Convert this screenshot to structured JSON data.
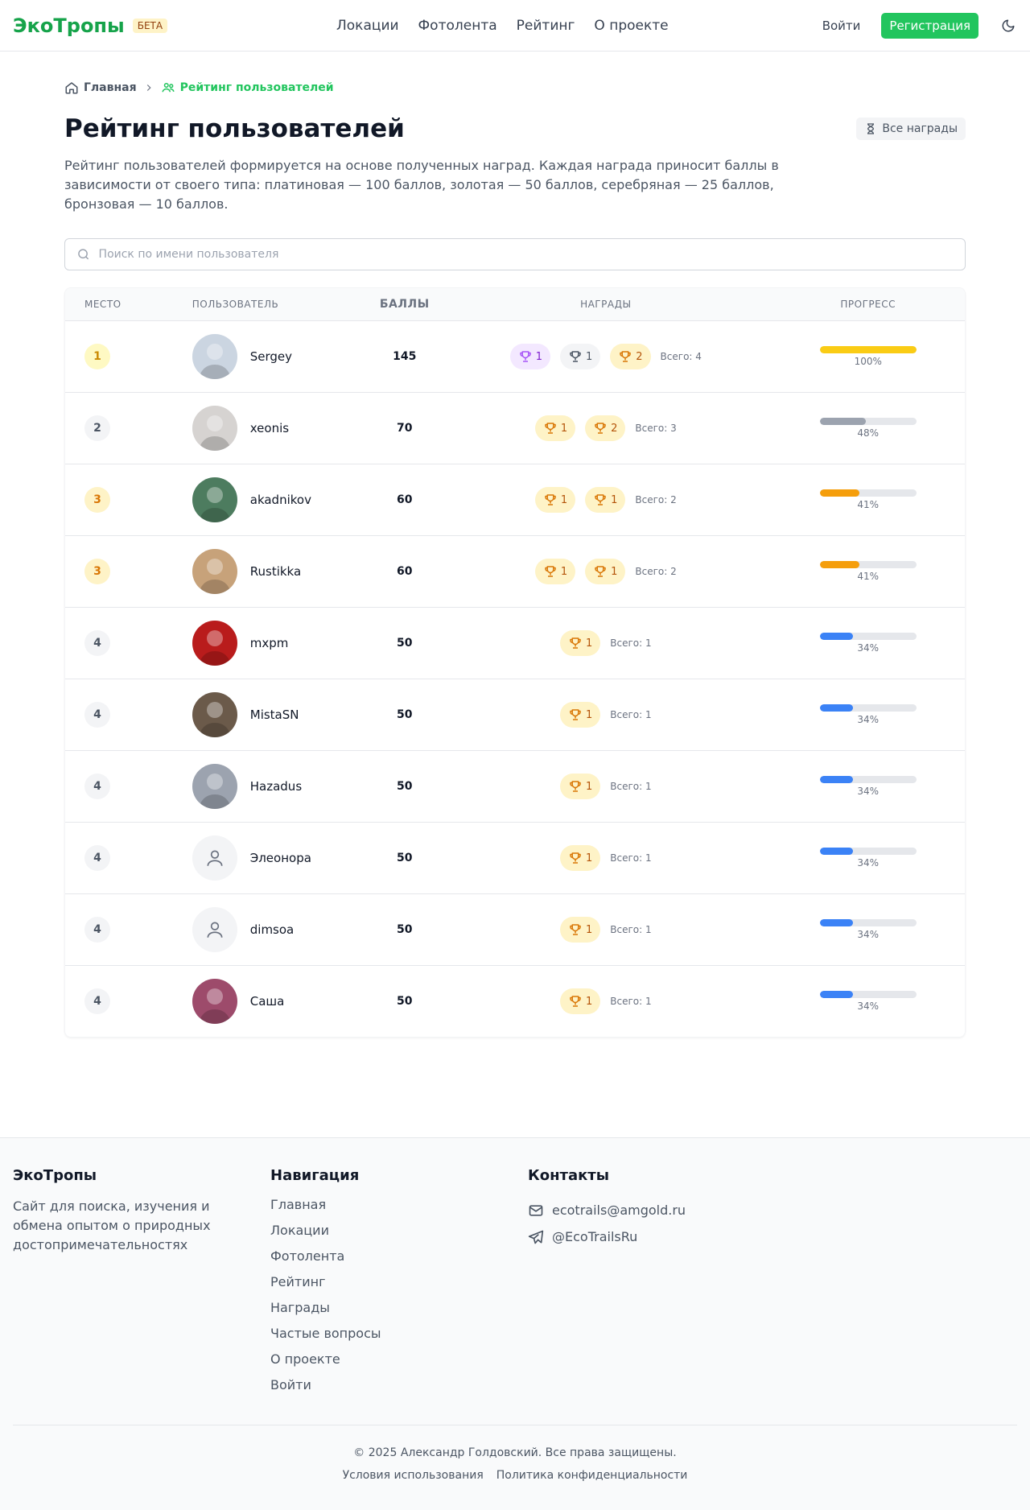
{
  "header": {
    "logo": "ЭкоТропы",
    "beta": "БЕТА",
    "nav": [
      "Локации",
      "Фотолента",
      "Рейтинг",
      "О проекте"
    ],
    "login": "Войти",
    "register": "Регистрация"
  },
  "breadcrumb": {
    "home": "Главная",
    "current": "Рейтинг пользователей"
  },
  "page": {
    "title": "Рейтинг пользователей",
    "all_awards": "Все награды",
    "description": "Рейтинг пользователей формируется на основе полученных наград. Каждая награда приносит баллы в зависимости от своего типа: платиновая — 100 баллов, золотая — 50 баллов, серебряная — 25 баллов, бронзовая — 10 баллов."
  },
  "search": {
    "placeholder": "Поиск по имени пользователя",
    "value": ""
  },
  "table": {
    "headers": [
      "МЕСТО",
      "ПОЛЬЗОВАТЕЛЬ",
      "БАЛЛЫ",
      "НАГРАДЫ",
      "ПРОГРЕСС"
    ],
    "rows": [
      {
        "rank": "1",
        "user": "Sergey",
        "points": "145",
        "awards": [
          {
            "type": "platinum",
            "count": "1"
          },
          {
            "type": "silver",
            "count": "1"
          },
          {
            "type": "gold",
            "count": "2"
          }
        ],
        "total": "Всего: 4",
        "progress": 1.0,
        "progress_label": "100%",
        "avatar": "photo"
      },
      {
        "rank": "2",
        "user": "xeonis",
        "points": "70",
        "awards": [
          {
            "type": "gold",
            "count": "1"
          },
          {
            "type": "gold",
            "count": "2"
          }
        ],
        "total": "Всего: 3",
        "progress": 0.48,
        "progress_label": "48%",
        "avatar": "photo"
      },
      {
        "rank": "3",
        "user": "akadnikov",
        "points": "60",
        "awards": [
          {
            "type": "gold",
            "count": "1"
          },
          {
            "type": "gold",
            "count": "1"
          }
        ],
        "total": "Всего: 2",
        "progress": 0.41,
        "progress_label": "41%",
        "avatar": "photo"
      },
      {
        "rank": "3",
        "user": "Rustikka",
        "points": "60",
        "awards": [
          {
            "type": "gold",
            "count": "1"
          },
          {
            "type": "gold",
            "count": "1"
          }
        ],
        "total": "Всего: 2",
        "progress": 0.41,
        "progress_label": "41%",
        "avatar": "photo"
      },
      {
        "rank": "4",
        "user": "mxpm",
        "points": "50",
        "awards": [
          {
            "type": "gold",
            "count": "1"
          }
        ],
        "total": "Всего: 1",
        "progress": 0.34,
        "progress_label": "34%",
        "avatar": "photo"
      },
      {
        "rank": "4",
        "user": "MistaSN",
        "points": "50",
        "awards": [
          {
            "type": "gold",
            "count": "1"
          }
        ],
        "total": "Всего: 1",
        "progress": 0.34,
        "progress_label": "34%",
        "avatar": "photo"
      },
      {
        "rank": "4",
        "user": "Hazadus",
        "points": "50",
        "awards": [
          {
            "type": "gold",
            "count": "1"
          }
        ],
        "total": "Всего: 1",
        "progress": 0.34,
        "progress_label": "34%",
        "avatar": "photo"
      },
      {
        "rank": "4",
        "user": "Элеонора",
        "points": "50",
        "awards": [
          {
            "type": "gold",
            "count": "1"
          }
        ],
        "total": "Всего: 1",
        "progress": 0.34,
        "progress_label": "34%",
        "avatar": "placeholder"
      },
      {
        "rank": "4",
        "user": "dimsoa",
        "points": "50",
        "awards": [
          {
            "type": "gold",
            "count": "1"
          }
        ],
        "total": "Всего: 1",
        "progress": 0.34,
        "progress_label": "34%",
        "avatar": "placeholder"
      },
      {
        "rank": "4",
        "user": "Саша",
        "points": "50",
        "awards": [
          {
            "type": "gold",
            "count": "1"
          }
        ],
        "total": "Всего: 1",
        "progress": 0.34,
        "progress_label": "34%",
        "avatar": "photo"
      }
    ]
  },
  "footer": {
    "about_title": "ЭкоТропы",
    "about_text": "Сайт для поиска, изучения и обмена опытом о природных достопримечательностях",
    "nav_title": "Навигация",
    "nav_links": [
      "Главная",
      "Локации",
      "Фотолента",
      "Рейтинг",
      "Награды",
      "Частые вопросы",
      "О проекте",
      "Войти"
    ],
    "contacts_title": "Контакты",
    "email": "ecotrails@amgold.ru",
    "telegram": "@EcoTrailsRu",
    "copyright": "© 2025 Александр Голдовский. Все права защищены.",
    "terms": "Условия использования",
    "privacy": "Политика конфиденциальности"
  },
  "colors": {
    "brand": "#16a34a",
    "register": "#22c55e",
    "gold": "#facc15",
    "silver": "#9ca3af",
    "bronze": "#f59e0b",
    "blue": "#3b82f6",
    "platinum": "#a855f7"
  }
}
